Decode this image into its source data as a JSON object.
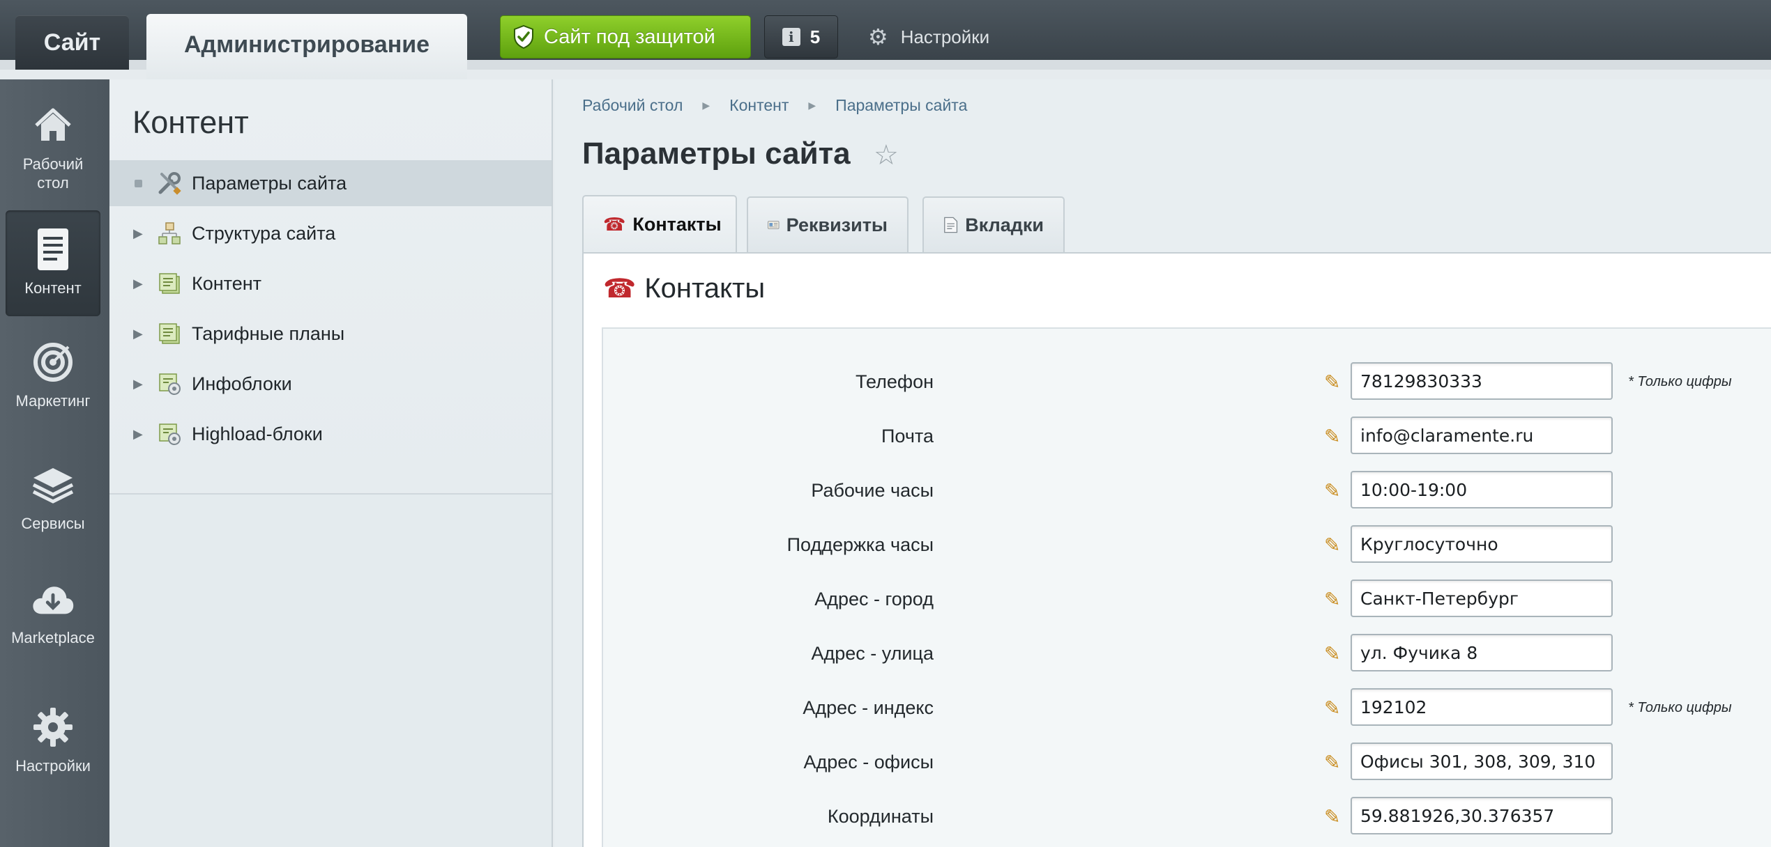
{
  "topbar": {
    "site_tab": "Сайт",
    "admin_tab": "Администрирование",
    "protect_button": "Сайт под защитой",
    "notifications_count": "5",
    "settings_label": "Настройки"
  },
  "leftbar": {
    "items": [
      {
        "label": "Рабочий стол",
        "icon": "home-icon"
      },
      {
        "label": "Контент",
        "icon": "document-icon"
      },
      {
        "label": "Маркетинг",
        "icon": "target-icon"
      },
      {
        "label": "Сервисы",
        "icon": "layers-icon"
      },
      {
        "label": "Marketplace",
        "icon": "cloud-download-icon"
      },
      {
        "label": "Настройки",
        "icon": "gear-icon"
      }
    ],
    "active_index": 1
  },
  "panel": {
    "title": "Контент",
    "items": [
      {
        "label": "Параметры сайта",
        "icon": "tools-icon",
        "selected": true
      },
      {
        "label": "Структура сайта",
        "icon": "structure-icon"
      },
      {
        "label": "Контент",
        "icon": "content-icon"
      },
      {
        "label": "Тарифные планы",
        "icon": "content-icon"
      },
      {
        "label": "Инфоблоки",
        "icon": "infoblock-icon"
      },
      {
        "label": "Highload-блоки",
        "icon": "infoblock-icon"
      }
    ]
  },
  "breadcrumb": [
    "Рабочий стол",
    "Контент",
    "Параметры сайта"
  ],
  "page_title": "Параметры сайта",
  "tabs": [
    {
      "label": "Контакты",
      "icon": "phone-icon"
    },
    {
      "label": "Реквизиты",
      "icon": "card-icon"
    },
    {
      "label": "Вкладки",
      "icon": "page-icon"
    }
  ],
  "section_title": "Контакты",
  "fields": [
    {
      "label": "Телефон",
      "value": "78129830333",
      "hint": "* Только цифры"
    },
    {
      "label": "Почта",
      "value": "info@claramente.ru",
      "hint": ""
    },
    {
      "label": "Рабочие часы",
      "value": "10:00-19:00",
      "hint": ""
    },
    {
      "label": "Поддержка часы",
      "value": "Круглосуточно",
      "hint": ""
    },
    {
      "label": "Адрес - город",
      "value": "Санкт-Петербург",
      "hint": ""
    },
    {
      "label": "Адрес - улица",
      "value": "ул. Фучика 8",
      "hint": ""
    },
    {
      "label": "Адрес - индекс",
      "value": "192102",
      "hint": "* Только цифры"
    },
    {
      "label": "Адрес - офисы",
      "value": "Офисы 301, 308, 309, 310",
      "hint": ""
    },
    {
      "label": "Координаты",
      "value": "59.881926,30.376357",
      "hint": ""
    }
  ],
  "colors": {
    "topbar": "#434c53",
    "protect_green": "#6fb31a",
    "link": "#4b6f8a",
    "phone_red": "#c0282d"
  }
}
